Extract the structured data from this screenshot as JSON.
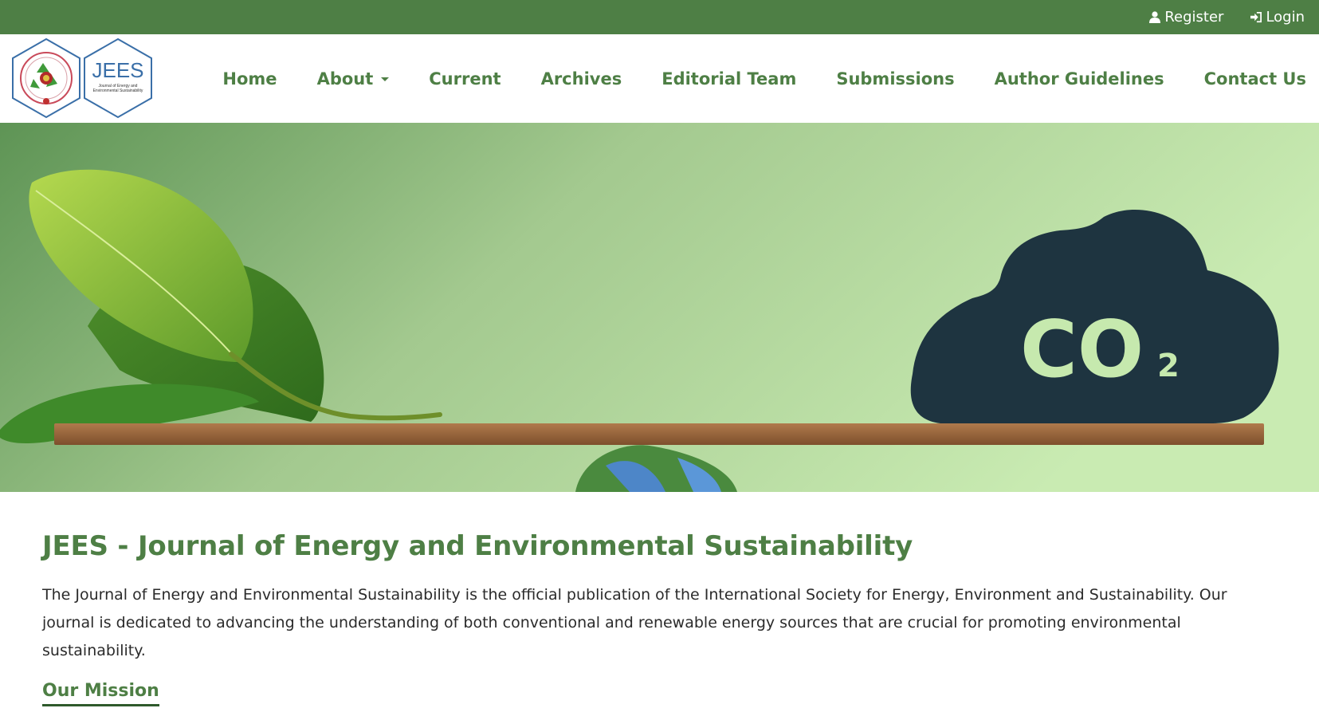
{
  "topbar": {
    "register_label": "Register",
    "login_label": "Login",
    "background": "#4e7f45"
  },
  "logo": {
    "text": "JEES",
    "subtitle_line1": "Journal of Energy and",
    "subtitle_line2": "Environmental Sustainability"
  },
  "nav": {
    "items": [
      {
        "label": "Home"
      },
      {
        "label": "About"
      },
      {
        "label": "Current"
      },
      {
        "label": "Archives"
      },
      {
        "label": "Editorial Team"
      },
      {
        "label": "Submissions"
      },
      {
        "label": "Author Guidelines"
      },
      {
        "label": "Contact Us"
      }
    ],
    "accent": "#4e7f45"
  },
  "hero": {
    "cloud_text": "CO",
    "cloud_subscript": "2"
  },
  "main": {
    "title": "JEES - Journal of Energy and Environmental Sustainability",
    "description": "The Journal of Energy and Environmental Sustainability is the official publication of the International Society for Energy, Environment and Sustainability. Our journal is dedicated to advancing the understanding of both conventional and renewable energy sources that are crucial for promoting environmental sustainability.",
    "mission_heading": "Our Mission"
  }
}
